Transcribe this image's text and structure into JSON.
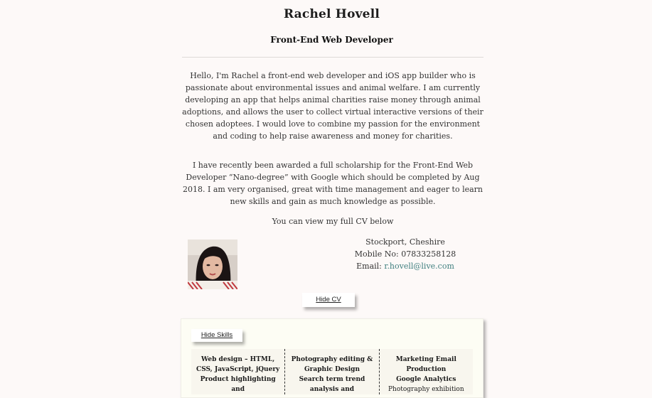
{
  "header": {
    "name": "Rachel Hovell",
    "role": "Front-End Web Developer"
  },
  "bio": {
    "paragraph1": "Hello, I'm Rachel a front-end web developer and iOS app builder who is passionate about environmental issues and animal welfare. I am currently developing an app that helps animal charities raise money through animal adoptions, and allows the user to collect virtual interactive versions of their chosen adoptees. I would love to combine my passion for the environment and coding to help raise awareness and money for charities.",
    "paragraph2": "I have recently been awarded a full scholarship for the Front-End Web Developer “Nano-degree” with Google which should be completed by Aug 2018. I am very organised, great with time management and eager to learn new skills and gain as much knowledge as possible.",
    "cv_note": "You can view my full CV below"
  },
  "contact": {
    "location": "Stockport, Cheshire",
    "mobile": "Mobile No: 07833258128",
    "email_label": "Email: ",
    "email": "r.hovell@live.com"
  },
  "buttons": {
    "hide_cv": "Hide CV",
    "hide_skills": "Hide Skills"
  },
  "skills": {
    "col1": [
      "Web design – HTML, CSS, JavaScript, jQuery",
      "Product highlighting and"
    ],
    "col2": [
      "Photography editing & Graphic Design",
      "Search term trend analysis and"
    ],
    "col3": [
      "Marketing Email Production",
      "Google Analytics",
      "Photography exhibition"
    ]
  },
  "colors": {
    "background": "#fdf9f8",
    "link": "#3f7f7f",
    "panel": "#fdfdf4"
  }
}
